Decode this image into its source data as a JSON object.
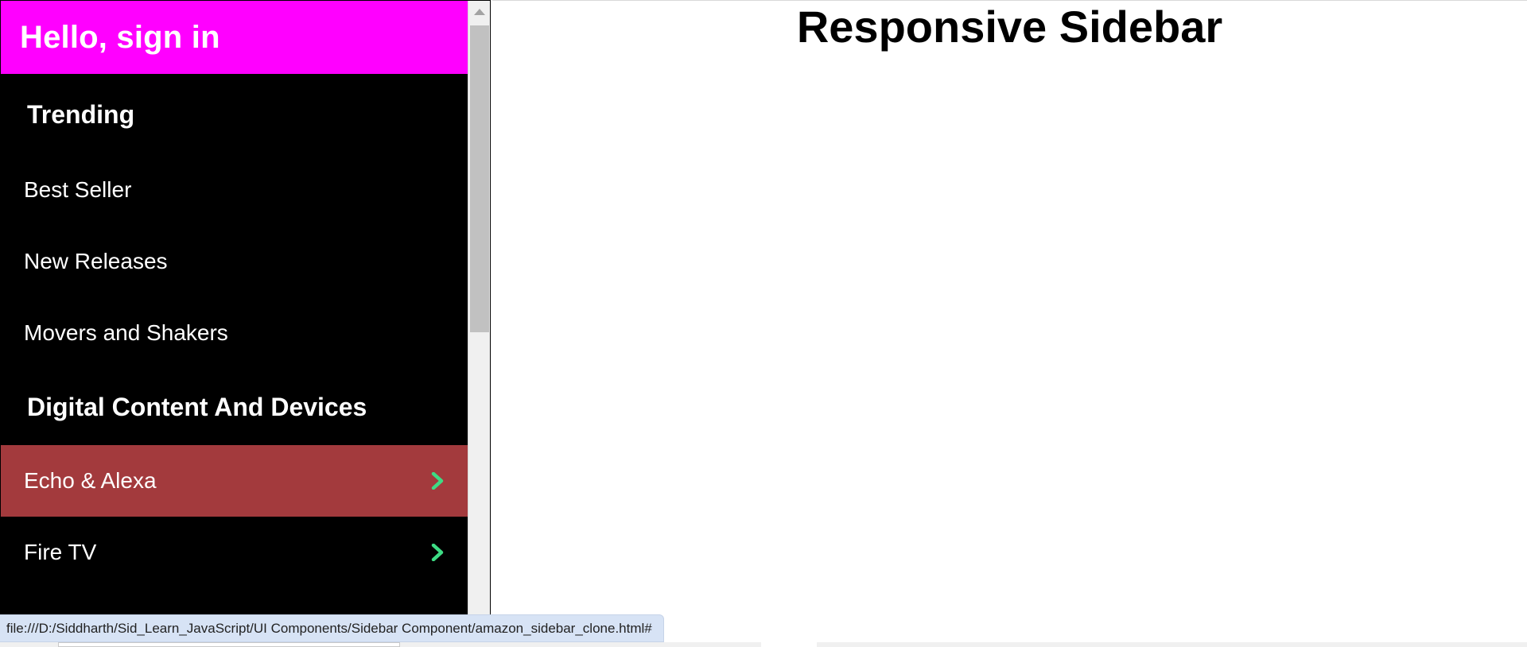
{
  "sidebar": {
    "header": "Hello, sign in",
    "sections": [
      {
        "title": "Trending",
        "items": [
          {
            "label": "Best Seller"
          },
          {
            "label": "New Releases"
          },
          {
            "label": "Movers and Shakers"
          }
        ]
      },
      {
        "title": "Digital Content And Devices",
        "items": [
          {
            "label": "Echo & Alexa",
            "icon": "chevron-right-icon",
            "active": true
          },
          {
            "label": "Fire TV",
            "icon": "chevron-right-icon"
          }
        ]
      }
    ]
  },
  "main": {
    "title": "Responsive Sidebar"
  },
  "status_bar": {
    "url": "file:///D:/Siddharth/Sid_Learn_JavaScript/UI Components/Sidebar Component/amazon_sidebar_clone.html#"
  },
  "colors": {
    "header_bg": "#ff00ff",
    "sidebar_bg": "#000000",
    "active_item_bg": "#a33a3d",
    "chevron": "#3ddc84"
  }
}
